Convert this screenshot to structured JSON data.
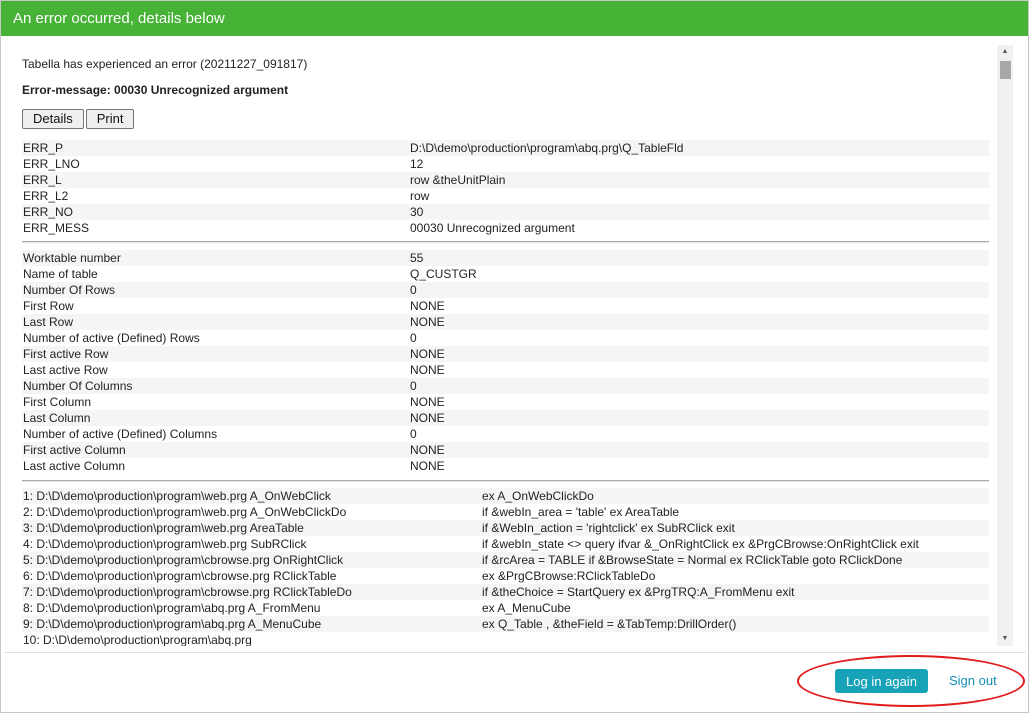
{
  "dialog": {
    "title": "An error occurred, details below",
    "intro": "Tabella has experienced an error (20211227_091817)",
    "error_message": "Error-message: 00030 Unrecognized argument",
    "buttons": {
      "details": "Details",
      "print": "Print"
    }
  },
  "error_fields": [
    {
      "key": "ERR_P",
      "value": "D:\\D\\demo\\production\\program\\abq.prg\\Q_TableFld"
    },
    {
      "key": "ERR_LNO",
      "value": "12"
    },
    {
      "key": "ERR_L",
      "value": "row &theUnitPlain"
    },
    {
      "key": "ERR_L2",
      "value": "row"
    },
    {
      "key": "ERR_NO",
      "value": "30"
    },
    {
      "key": "ERR_MESS",
      "value": "00030 Unrecognized argument"
    }
  ],
  "worktable_fields": [
    {
      "key": "Worktable number",
      "value": "55"
    },
    {
      "key": "Name of table",
      "value": "Q_CUSTGR"
    },
    {
      "key": "Number Of Rows",
      "value": "0"
    },
    {
      "key": "First Row",
      "value": "NONE"
    },
    {
      "key": "Last Row",
      "value": "NONE"
    },
    {
      "key": "Number of active (Defined) Rows",
      "value": "0"
    },
    {
      "key": "First active Row",
      "value": "NONE"
    },
    {
      "key": "Last active Row",
      "value": "NONE"
    },
    {
      "key": "Number Of Columns",
      "value": "0"
    },
    {
      "key": "First Column",
      "value": "NONE"
    },
    {
      "key": "Last Column",
      "value": "NONE"
    },
    {
      "key": "Number of active (Defined) Columns",
      "value": "0"
    },
    {
      "key": "First active Column",
      "value": "NONE"
    },
    {
      "key": "Last active Column",
      "value": "NONE"
    }
  ],
  "stack_trace": [
    {
      "key": "1: D:\\D\\demo\\production\\program\\web.prg A_OnWebClick",
      "value": "ex A_OnWebClickDo"
    },
    {
      "key": "2: D:\\D\\demo\\production\\program\\web.prg A_OnWebClickDo",
      "value": "if &webIn_area = 'table' ex AreaTable"
    },
    {
      "key": "3: D:\\D\\demo\\production\\program\\web.prg AreaTable",
      "value": "if &WebIn_action = 'rightclick' ex SubRClick exit"
    },
    {
      "key": "4: D:\\D\\demo\\production\\program\\web.prg SubRClick",
      "value": "if &webIn_state <> query ifvar &_OnRightClick ex &PrgCBrowse:OnRightClick exit"
    },
    {
      "key": "5: D:\\D\\demo\\production\\program\\cbrowse.prg OnRightClick",
      "value": "if &rcArea = TABLE if &BrowseState = Normal ex RClickTable goto RClickDone"
    },
    {
      "key": "6: D:\\D\\demo\\production\\program\\cbrowse.prg RClickTable",
      "value": "ex &PrgCBrowse:RClickTableDo"
    },
    {
      "key": "7: D:\\D\\demo\\production\\program\\cbrowse.prg RClickTableDo",
      "value": "if &theChoice = StartQuery ex &PrgTRQ:A_FromMenu exit"
    },
    {
      "key": "8: D:\\D\\demo\\production\\program\\abq.prg A_FromMenu",
      "value": "ex A_MenuCube"
    },
    {
      "key": "9: D:\\D\\demo\\production\\program\\abq.prg A_MenuCube",
      "value": "ex Q_Table , &theField = &TabTemp:DrillOrder()"
    },
    {
      "key": "10: D:\\D\\demo\\production\\program\\abq.prg",
      "value": ""
    }
  ],
  "footer": {
    "login_label": "Log in again",
    "signout_label": "Sign out"
  },
  "colors": {
    "header": "#46b336",
    "login_button": "#17a2b8",
    "annotation": "#e21b1b"
  },
  "icons": {
    "scroll_up": "triangle-up",
    "scroll_down": "triangle-down"
  }
}
